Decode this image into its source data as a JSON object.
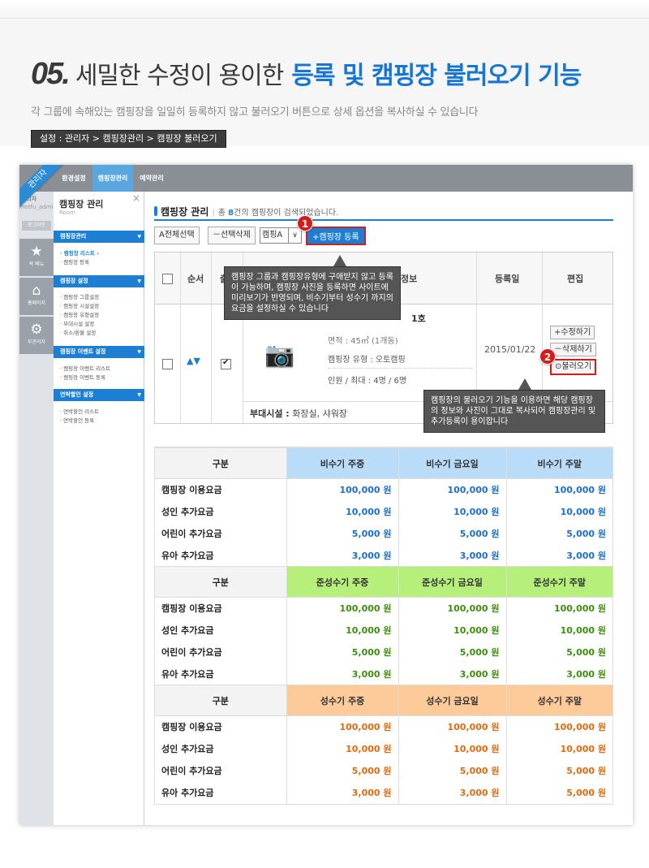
{
  "headline": {
    "number": "05.",
    "grey": "세밀한 수정이 용이한",
    "blue": "등록 및 캠핑장 불러오기 기능"
  },
  "subline": "각 그룹에 속해있는 캠핑장을 일일히 등록하지 않고 불러오기 버튼으로 상세 옵션을 복사하실 수 있습니다",
  "breadcrumb": "설정 : 관리자 > 캠핑장관리 > 캠핑장 불러오기",
  "app": {
    "ribbon": "관리자",
    "tabs": [
      "환경설정",
      "캠핑장관리",
      "예약관리"
    ],
    "rail": {
      "user_name": "관리자",
      "user_id": "netfu_admin",
      "logout": "로그아웃",
      "buttons": [
        {
          "icon": "★",
          "label": "픽 메뉴"
        },
        {
          "icon": "⌂",
          "label": "홈페이지"
        },
        {
          "icon": "⚙",
          "label": "부관리자"
        }
      ]
    },
    "side": {
      "title": "캠핑장 관리",
      "subtitle": "Room",
      "sections": [
        {
          "title": "캠핑장관리",
          "items": [
            "· 캠핑장 리스트 ›",
            "· 캠핑장 등록"
          ]
        },
        {
          "title": "캠핑장 설정",
          "items": [
            "· 캠핑장 그룹설정",
            "· 캠핑장 시설설정",
            "· 캠핑장 유형설정",
            "· 부대시설 설정",
            "· 취소/환불 설정"
          ]
        },
        {
          "title": "캠핑장 이벤트 설정",
          "items": [
            "· 캠핑장 이벤트 리스트",
            "· 캠핑장 이벤트 등록"
          ]
        },
        {
          "title": "연박할인 설정",
          "items": [
            "· 연박할인 리스트",
            "· 연박할인 등록"
          ]
        }
      ]
    },
    "main": {
      "title": "캠핑장 관리",
      "info_prefix": "총",
      "count": "8",
      "info_suffix": "건의 캠핑장이 검색되었습니다.",
      "toolbar": {
        "select_all": "A전체선택",
        "delete_sel": "－선택삭제",
        "select_value": "캠핑A",
        "register": "+캠핑장 등록"
      },
      "badge1": "1",
      "badge2": "2",
      "grid": {
        "col_order": "순서",
        "col_visible": "출",
        "col_info": "정보",
        "col_date": "등록일",
        "col_edit": "편집",
        "room_name": "1호",
        "line1": "면적 : 45㎡ (1개동)",
        "type": "캠핑장 유형 : 오토캠핑",
        "people": "인원 / 최대 : 4명 / 6명",
        "date": "2015/01/22",
        "edit_btn": "+수정하기",
        "delete_btn": "－삭제하기",
        "load_btn": "⊙불러오기",
        "facility_label": "부대시설 :",
        "facility_value": "화장실, 샤워장"
      },
      "tip1": "캠핑장 그룹과 캠핑장유형에 구애받지 않고 등록이 가능하며, 캠핑장 사진을 등록하면 사이트에 미리보기가 반영되며, 비수기부터 성수기 까지의 요금을 설정하실 수 있습니다",
      "tip2": "캠핑장의 불러오기 기능을 이용하면 해당 캠핑장의 정보와 사진이 그대로 복사되어 캠핑장관리 및 추가등록이 용이합니다",
      "price_blocks": [
        {
          "header": [
            "구분",
            "비수기 주중",
            "비수기 금요일",
            "비수기 주말"
          ],
          "header_color": "#b9dcf8",
          "value_color": "#1c6fd0",
          "rows": [
            [
              "캠핑장 이용요금",
              "100,000 원",
              "100,000 원",
              "100,000 원"
            ],
            [
              "성인 추가요금",
              "10,000 원",
              "10,000 원",
              "10,000 원"
            ],
            [
              "어린이 추가요금",
              "5,000 원",
              "5,000 원",
              "5,000 원"
            ],
            [
              "유아 추가요금",
              "3,000 원",
              "3,000 원",
              "3,000 원"
            ]
          ]
        },
        {
          "header": [
            "구분",
            "준성수기 주중",
            "준성수기 금요일",
            "준성수기 주말"
          ],
          "header_color": "#b6f07a",
          "value_color": "#3d8f0c",
          "rows": [
            [
              "캠핑장 이용요금",
              "100,000 원",
              "100,000 원",
              "100,000 원"
            ],
            [
              "성인 추가요금",
              "10,000 원",
              "10,000 원",
              "10,000 원"
            ],
            [
              "어린이 추가요금",
              "5,000 원",
              "5,000 원",
              "5,000 원"
            ],
            [
              "유아 추가요금",
              "3,000 원",
              "3,000 원",
              "3,000 원"
            ]
          ]
        },
        {
          "header": [
            "구분",
            "성수기 주중",
            "성수기 금요일",
            "성수기 주말"
          ],
          "header_color": "#fdcb9a",
          "value_color": "#e06a10",
          "rows": [
            [
              "캠핑장 이용요금",
              "100,000 원",
              "100,000 원",
              "100,000 원"
            ],
            [
              "성인 추가요금",
              "10,000 원",
              "10,000 원",
              "10,000 원"
            ],
            [
              "어린이 추가요금",
              "5,000 원",
              "5,000 원",
              "5,000 원"
            ],
            [
              "유아 추가요금",
              "3,000 원",
              "3,000 원",
              "5,000 원"
            ]
          ]
        }
      ]
    }
  }
}
